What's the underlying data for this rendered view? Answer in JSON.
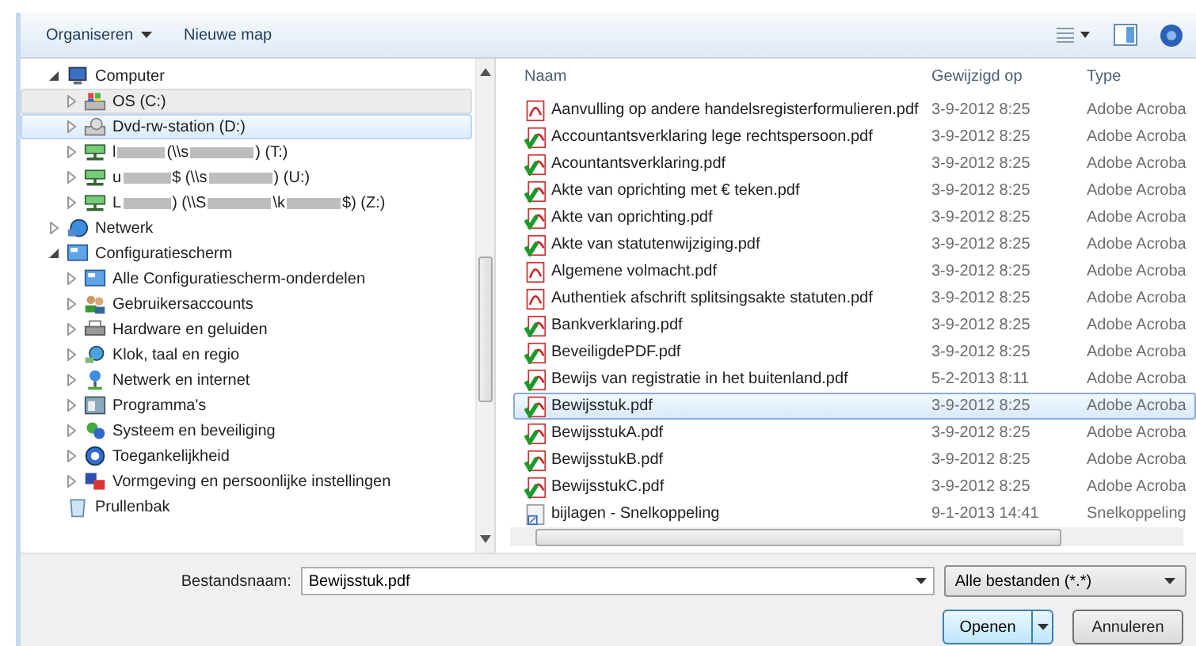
{
  "toolbar": {
    "buttons": [
      {
        "label": "Organiseren",
        "dropdown": true
      },
      {
        "label": "Nieuwe map",
        "dropdown": false
      }
    ]
  },
  "navigation": {
    "items": [
      {
        "label": "Computer",
        "kind": "computer",
        "expandable": true,
        "expanded": true,
        "selected": false,
        "hovered": false,
        "children": [
          {
            "label": "OS (C:)",
            "kind": "system-drive",
            "expandable": true,
            "expanded": false,
            "selected": false,
            "hovered": true
          },
          {
            "label": "Dvd-rw-station (D:)",
            "kind": "dvd",
            "expandable": true,
            "expanded": false,
            "selected": true,
            "hovered": false
          },
          {
            "label_parts": [
              "l",
              "(\\\\s",
              ") (T:)"
            ],
            "kind": "network-drive",
            "expandable": true,
            "expanded": false,
            "selected": false,
            "hovered": false
          },
          {
            "label_parts": [
              "u",
              "$ (\\\\s",
              ") (U:)"
            ],
            "kind": "network-drive",
            "expandable": true,
            "expanded": false,
            "selected": false,
            "hovered": false
          },
          {
            "label_parts": [
              "L",
              ") (\\\\S",
              "\\k",
              "$) (Z:)"
            ],
            "kind": "network-drive",
            "expandable": true,
            "expanded": false,
            "selected": false,
            "hovered": false
          }
        ]
      },
      {
        "label": "Netwerk",
        "kind": "network",
        "expandable": true,
        "expanded": false,
        "selected": false,
        "hovered": false
      },
      {
        "label": "Configuratiescherm",
        "kind": "control-panel",
        "expandable": true,
        "expanded": true,
        "selected": false,
        "hovered": false,
        "children": [
          {
            "label": "Alle Configuratiescherm-onderdelen",
            "kind": "control-panel",
            "expandable": true,
            "expanded": false,
            "selected": false,
            "hovered": false
          },
          {
            "label": "Gebruikersaccounts",
            "kind": "users",
            "expandable": true,
            "expanded": false,
            "selected": false,
            "hovered": false
          },
          {
            "label": "Hardware en geluiden",
            "kind": "hardware",
            "expandable": true,
            "expanded": false,
            "selected": false,
            "hovered": false
          },
          {
            "label": "Klok, taal en regio",
            "kind": "clock",
            "expandable": true,
            "expanded": false,
            "selected": false,
            "hovered": false
          },
          {
            "label": "Netwerk en internet",
            "kind": "network-internet",
            "expandable": true,
            "expanded": false,
            "selected": false,
            "hovered": false
          },
          {
            "label": "Programma's",
            "kind": "programs",
            "expandable": true,
            "expanded": false,
            "selected": false,
            "hovered": false
          },
          {
            "label": "Systeem en beveiliging",
            "kind": "security",
            "expandable": true,
            "expanded": false,
            "selected": false,
            "hovered": false
          },
          {
            "label": "Toegankelijkheid",
            "kind": "accessibility",
            "expandable": true,
            "expanded": false,
            "selected": false,
            "hovered": false
          },
          {
            "label": "Vormgeving en persoonlijke instellingen",
            "kind": "appearance",
            "expandable": true,
            "expanded": false,
            "selected": false,
            "hovered": false
          }
        ]
      },
      {
        "label": "Prullenbak",
        "kind": "recycle-bin",
        "expandable": false,
        "selected": false,
        "hovered": false
      }
    ]
  },
  "file_list": {
    "columns": [
      "Naam",
      "Gewijzigd op",
      "Type"
    ],
    "rows": [
      {
        "name": "Aanvulling op andere handelsregisterformulieren.pdf",
        "modified": "3-9-2012 8:25",
        "type": "Adobe Acroba",
        "kind": "pdf",
        "selected": false
      },
      {
        "name": "Accountantsverklaring lege rechtspersoon.pdf",
        "modified": "3-9-2012 8:25",
        "type": "Adobe Acroba",
        "kind": "pdf-signed",
        "selected": false
      },
      {
        "name": "Acountantsverklaring.pdf",
        "modified": "3-9-2012 8:25",
        "type": "Adobe Acroba",
        "kind": "pdf-signed",
        "selected": false
      },
      {
        "name": "Akte van oprichting met € teken.pdf",
        "modified": "3-9-2012 8:25",
        "type": "Adobe Acroba",
        "kind": "pdf-signed",
        "selected": false
      },
      {
        "name": "Akte van oprichting.pdf",
        "modified": "3-9-2012 8:25",
        "type": "Adobe Acroba",
        "kind": "pdf-signed",
        "selected": false
      },
      {
        "name": "Akte van statutenwijziging.pdf",
        "modified": "3-9-2012 8:25",
        "type": "Adobe Acroba",
        "kind": "pdf-signed",
        "selected": false
      },
      {
        "name": "Algemene volmacht.pdf",
        "modified": "3-9-2012 8:25",
        "type": "Adobe Acroba",
        "kind": "pdf",
        "selected": false
      },
      {
        "name": "Authentiek afschrift splitsingsakte statuten.pdf",
        "modified": "3-9-2012 8:25",
        "type": "Adobe Acroba",
        "kind": "pdf",
        "selected": false
      },
      {
        "name": "Bankverklaring.pdf",
        "modified": "3-9-2012 8:25",
        "type": "Adobe Acroba",
        "kind": "pdf-signed",
        "selected": false
      },
      {
        "name": "BeveiligdePDF.pdf",
        "modified": "3-9-2012 8:25",
        "type": "Adobe Acroba",
        "kind": "pdf-signed",
        "selected": false
      },
      {
        "name": "Bewijs van registratie in het buitenland.pdf",
        "modified": "5-2-2013 8:11",
        "type": "Adobe Acroba",
        "kind": "pdf-signed",
        "selected": false
      },
      {
        "name": "Bewijsstuk.pdf",
        "modified": "3-9-2012 8:25",
        "type": "Adobe Acroba",
        "kind": "pdf-signed",
        "selected": true
      },
      {
        "name": "BewijsstukA.pdf",
        "modified": "3-9-2012 8:25",
        "type": "Adobe Acroba",
        "kind": "pdf-signed",
        "selected": false
      },
      {
        "name": "BewijsstukB.pdf",
        "modified": "3-9-2012 8:25",
        "type": "Adobe Acroba",
        "kind": "pdf-signed",
        "selected": false
      },
      {
        "name": "BewijsstukC.pdf",
        "modified": "3-9-2012 8:25",
        "type": "Adobe Acroba",
        "kind": "pdf-signed",
        "selected": false
      },
      {
        "name": "bijlagen - Snelkoppeling",
        "modified": "9-1-2013 14:41",
        "type": "Snelkoppeling",
        "kind": "shortcut",
        "selected": false
      }
    ]
  },
  "filename": {
    "label": "Bestandsnaam:",
    "value": "Bewijsstuk.pdf"
  },
  "filter": {
    "value": "Alle bestanden (*.*)"
  },
  "buttons": {
    "open": "Openen",
    "cancel": "Annuleren"
  }
}
